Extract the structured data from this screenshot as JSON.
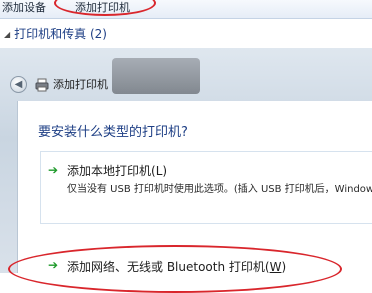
{
  "toolbar": {
    "add_device_label": "添加设备",
    "add_printer_label": "添加打印机"
  },
  "group": {
    "expand_glyph": "◢",
    "title": "打印机和传真 (2)"
  },
  "wizard": {
    "back_glyph": "◀",
    "title": "添加打印机",
    "question": "要安装什么类型的打印机?",
    "options": [
      {
        "arrow": "➔",
        "title_prefix": "添加本地打印机(",
        "title_key": "L",
        "title_suffix": ")",
        "description": "仅当没有 USB 打印机时使用此选项。(插入 USB 打印机后，Window"
      },
      {
        "arrow": "➔",
        "title_prefix": "添加网络、无线或 Bluetooth 打印机(",
        "title_key": "W",
        "title_suffix": ")"
      }
    ]
  },
  "colors": {
    "annotation": "#d9262c",
    "link_blue": "#1e3f85",
    "arrow_green": "#1f9a2b"
  },
  "icons": [
    "back-arrow-icon",
    "printer-icon",
    "green-arrow-icon",
    "expand-triangle-icon"
  ]
}
